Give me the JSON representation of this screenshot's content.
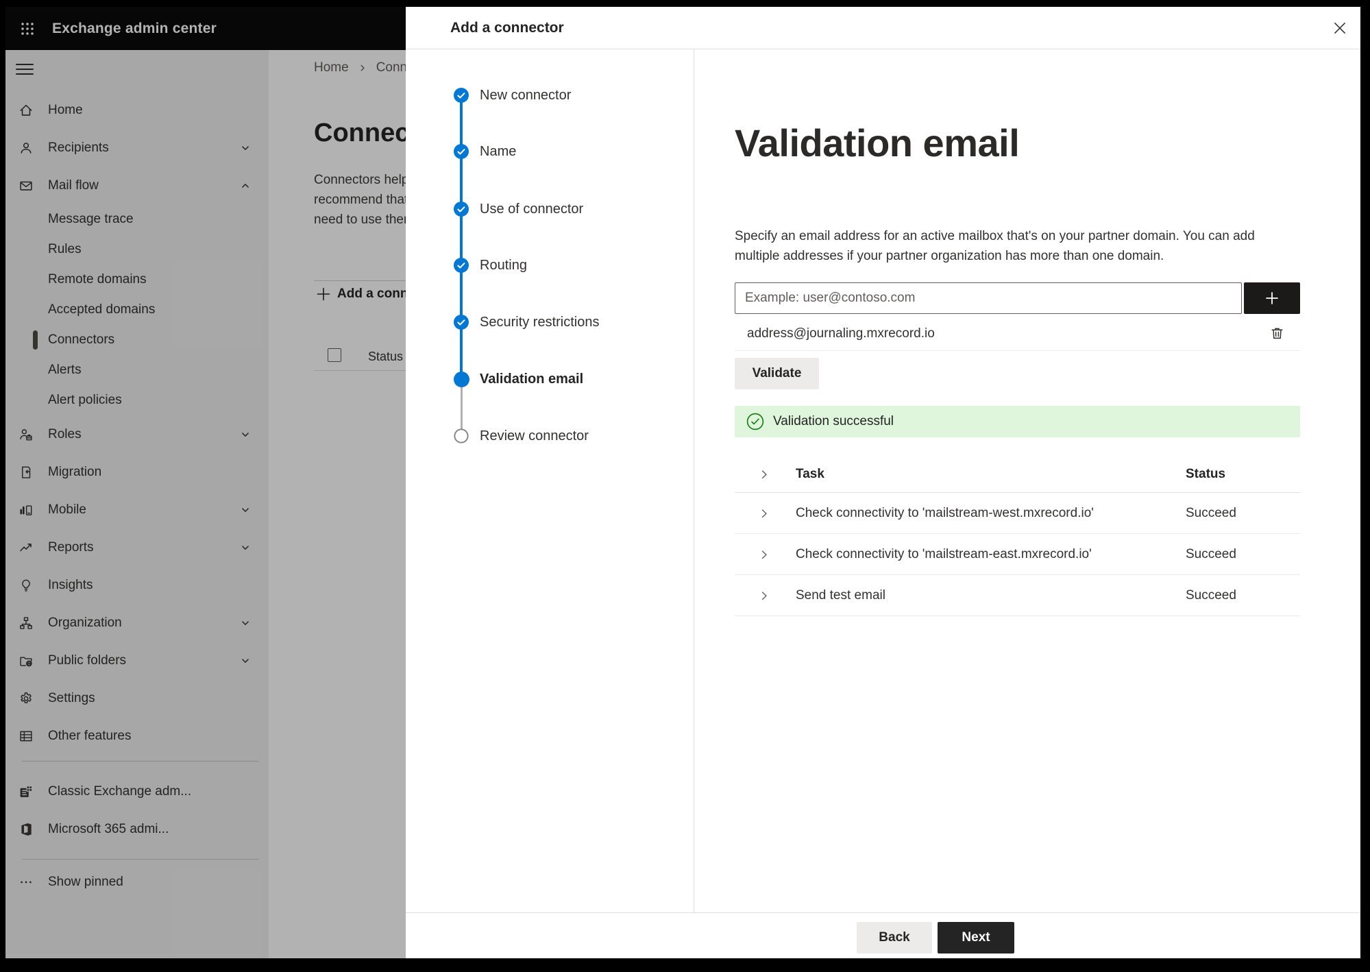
{
  "app": {
    "header_title": "Exchange admin center"
  },
  "sidebar": {
    "items": [
      {
        "label": "Home"
      },
      {
        "label": "Recipients"
      },
      {
        "label": "Mail flow"
      },
      {
        "label": "Message trace"
      },
      {
        "label": "Rules"
      },
      {
        "label": "Remote domains"
      },
      {
        "label": "Accepted domains"
      },
      {
        "label": "Connectors"
      },
      {
        "label": "Alerts"
      },
      {
        "label": "Alert policies"
      },
      {
        "label": "Roles"
      },
      {
        "label": "Migration"
      },
      {
        "label": "Mobile"
      },
      {
        "label": "Reports"
      },
      {
        "label": "Insights"
      },
      {
        "label": "Organization"
      },
      {
        "label": "Public folders"
      },
      {
        "label": "Settings"
      },
      {
        "label": "Other features"
      },
      {
        "label": "Classic Exchange adm..."
      },
      {
        "label": "Microsoft 365 admi..."
      },
      {
        "label": "Show pinned"
      }
    ]
  },
  "background": {
    "breadcrumb": {
      "home": "Home",
      "current": "Conne"
    },
    "page_title": "Connec",
    "intro_lines": [
      "Connectors help",
      "recommend that",
      "need to use ther"
    ],
    "add_button_label": "Add a conn",
    "list_header_status": "Status"
  },
  "modal": {
    "title": "Add a connector",
    "steps": [
      {
        "label": "New connector",
        "state": "completed"
      },
      {
        "label": "Name",
        "state": "completed"
      },
      {
        "label": "Use of connector",
        "state": "completed"
      },
      {
        "label": "Routing",
        "state": "completed"
      },
      {
        "label": "Security restrictions",
        "state": "completed"
      },
      {
        "label": "Validation email",
        "state": "current"
      },
      {
        "label": "Review connector",
        "state": "upcoming"
      }
    ],
    "content": {
      "heading": "Validation email",
      "description": "Specify an email address for an active mailbox that's on your partner domain. You can add multiple addresses if your partner organization has more than one domain.",
      "email_input_placeholder": "Example: user@contoso.com",
      "added_address": "address@journaling.mxrecord.io",
      "validate_button_label": "Validate",
      "success_message": "Validation successful",
      "table": {
        "task_header": "Task",
        "status_header": "Status",
        "rows": [
          {
            "task": "Check connectivity to 'mailstream-west.mxrecord.io'",
            "status": "Succeed"
          },
          {
            "task": "Check connectivity to 'mailstream-east.mxrecord.io'",
            "status": "Succeed"
          },
          {
            "task": "Send test email",
            "status": "Succeed"
          }
        ]
      }
    },
    "footer": {
      "back_label": "Back",
      "next_label": "Next"
    }
  },
  "colors": {
    "accent": "#0078d4",
    "success_bg": "#dff6dd",
    "success_green": "#107c10",
    "header_bg": "#000000",
    "primary_button": "#242424"
  }
}
